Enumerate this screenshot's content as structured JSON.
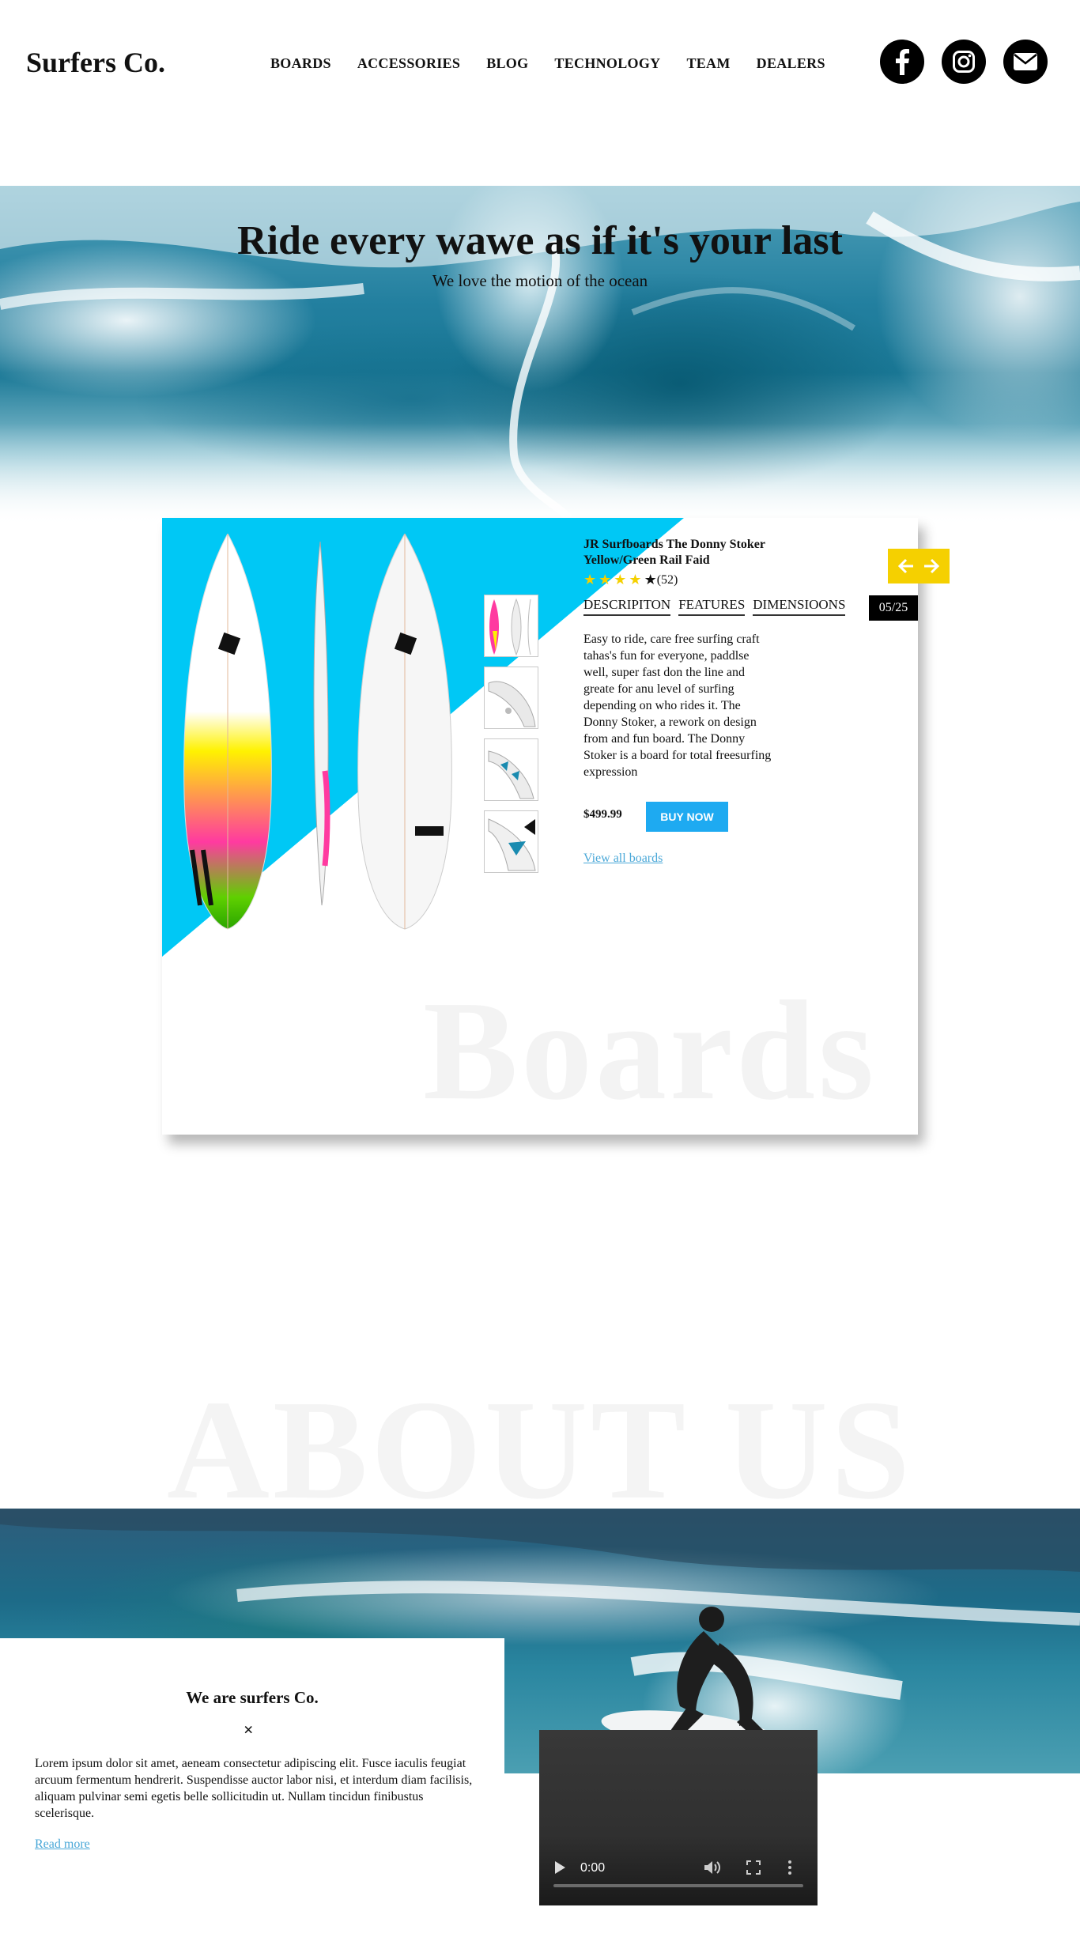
{
  "brand": "Surfers Co.",
  "nav": [
    "BOARDS",
    "ACCESSORIES",
    "BLOG",
    "TECHNOLOGY",
    "TEAM",
    "DEALERS"
  ],
  "social": [
    "facebook-icon",
    "instagram-icon",
    "envelope-icon"
  ],
  "hero": {
    "title": "Ride every wawe as if it's your last",
    "subtitle": "We love the motion of the ocean"
  },
  "product": {
    "title": "JR Surfboards The Donny Stoker Yellow/Green Rail Faid",
    "rating_value": 4,
    "rating_max": 5,
    "reviews": "(52)",
    "tabs": [
      "DESCRIPITON",
      "FEATURES",
      "DIMENSIOONS"
    ],
    "pager": "05/25",
    "description": "Easy to ride, care free surfing craft tahas's fun for everyone, paddlse well, super fast don the line and greate for anu level of surfing depending on who rides it. The Donny Stoker, a rework on design from and fun board. The Donny Stoker is a board for total freesurfing expression",
    "price": "$499.99",
    "buy_label": "BUY NOW",
    "view_all": "View all boards",
    "background_word": "Boards",
    "accent_color": "#00c8f5",
    "arrow_color": "#f5d000"
  },
  "about": {
    "background_word": "ABOUT US",
    "title": "We are surfers Co.",
    "close_symbol": "×",
    "text": "Lorem ipsum dolor sit amet, aeneam consectetur adipiscing elit. Fusce iaculis feugiat arcuum fermentum hendrerit. Suspendisse auctor labor nisi, et interdum diam facilisis, aliquam pulvinar semi egetis belle sollicitudin ut. Nullam tincidun finibustus scelerisque.",
    "read_more": "Read more"
  },
  "video": {
    "time": "0:00"
  }
}
